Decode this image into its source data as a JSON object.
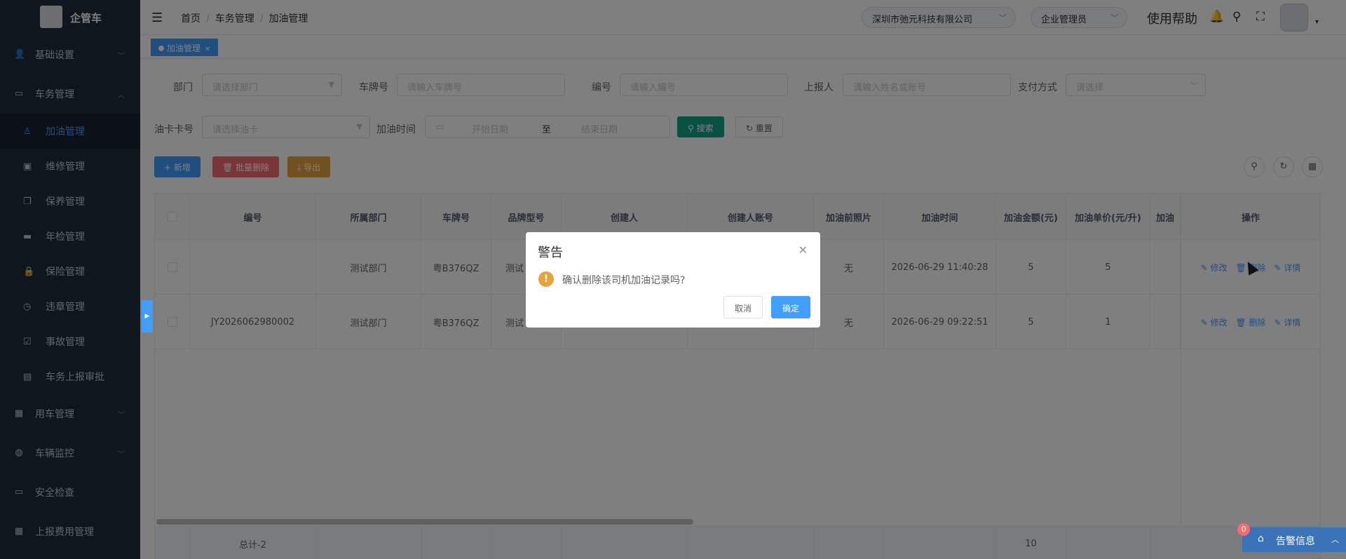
{
  "app": {
    "name": "企管车"
  },
  "sidebar": {
    "items": [
      {
        "label": "基础设置",
        "icon": "user-settings-icon"
      },
      {
        "label": "车务管理",
        "icon": "monitor-icon"
      },
      {
        "label": "用车管理",
        "icon": "document-icon"
      },
      {
        "label": "车辆监控",
        "icon": "globe-icon"
      },
      {
        "label": "安全检查",
        "icon": "calendar-icon"
      },
      {
        "label": "上报费用管理",
        "icon": "grid-icon"
      }
    ],
    "subitems": [
      {
        "label": "加油管理",
        "icon": "fuel-icon"
      },
      {
        "label": "维修管理",
        "icon": "toolbox-icon"
      },
      {
        "label": "保养管理",
        "icon": "copy-icon"
      },
      {
        "label": "年检管理",
        "icon": "car-icon"
      },
      {
        "label": "保险管理",
        "icon": "lock-icon"
      },
      {
        "label": "违章管理",
        "icon": "clock-icon"
      },
      {
        "label": "事故管理",
        "icon": "check-square-icon"
      },
      {
        "label": "车务上报审批",
        "icon": "file-icon"
      }
    ]
  },
  "header": {
    "breadcrumb": [
      "首页",
      "车务管理",
      "加油管理"
    ],
    "company": "深圳市弛元科技有限公司",
    "role": "企业管理员",
    "help": "使用帮助"
  },
  "tags": {
    "active": "加油管理"
  },
  "search": {
    "dept_label": "部门",
    "dept_placeholder": "请选择部门",
    "plate_label": "车牌号",
    "plate_placeholder": "请输入车牌号",
    "code_label": "编号",
    "code_placeholder": "请输入编号",
    "reporter_label": "上报人",
    "reporter_placeholder": "请输入姓名或账号",
    "pay_label": "支付方式",
    "pay_placeholder": "请选择",
    "card_label": "油卡卡号",
    "card_placeholder": "请选择油卡",
    "time_label": "加油时间",
    "start_placeholder": "开始日期",
    "to": "至",
    "end_placeholder": "结束日期",
    "search_btn": "搜索",
    "reset_btn": "重置"
  },
  "toolbar": {
    "add": "新增",
    "batch_delete": "批量删除",
    "export": "导出"
  },
  "table": {
    "headers": [
      "编号",
      "所属部门",
      "车牌号",
      "品牌型号",
      "创建人",
      "创建人账号",
      "加油前照片",
      "加油时间",
      "加油金额(元)",
      "加油单价(元/升)",
      "加油",
      "操作"
    ],
    "rows": [
      {
        "code": "",
        "dept": "测试部门",
        "plate": "粤B376QZ",
        "brand": "测试",
        "photo": "无",
        "time": "2026-06-29 11:40:28",
        "amount": "5",
        "price": "5"
      },
      {
        "code": "JY2026062980002",
        "dept": "测试部门",
        "plate": "粤B376QZ",
        "brand": "测试",
        "photo": "无",
        "time": "2026-06-29 09:22:51",
        "amount": "5",
        "price": "1"
      }
    ],
    "ops": {
      "edit": "修改",
      "delete": "删除",
      "detail": "详情"
    },
    "summary": {
      "label": "总计-2",
      "amount": "10"
    }
  },
  "dialog": {
    "title": "警告",
    "message": "确认删除该司机加油记录吗?",
    "cancel": "取消",
    "confirm": "确定"
  },
  "alert": {
    "label": "告警信息",
    "count": "0"
  },
  "colors": {
    "primary": "#409eff",
    "danger": "#f56c6c",
    "warning": "#e6a23c",
    "sidebar": "#1f2d3d",
    "search": "#13a586"
  }
}
